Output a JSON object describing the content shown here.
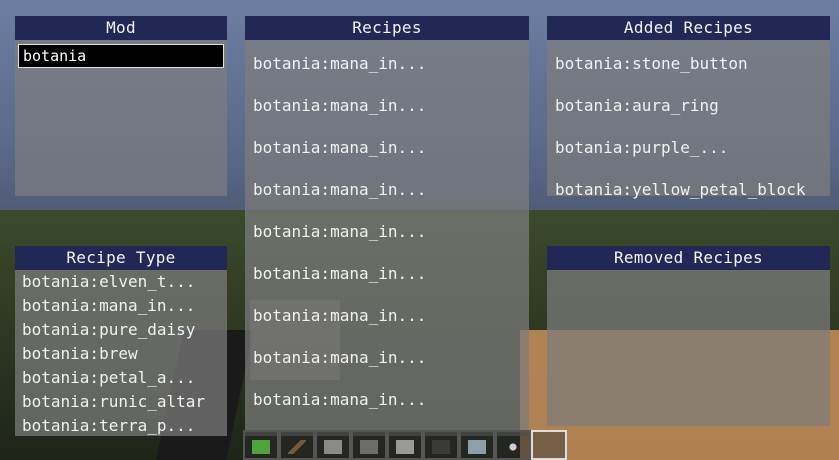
{
  "mod_panel": {
    "title": "Mod",
    "search_value": "botania"
  },
  "recipes_panel": {
    "title": "Recipes",
    "items": [
      "botania:mana_in...",
      "botania:mana_in...",
      "botania:mana_in...",
      "botania:mana_in...",
      "botania:mana_in...",
      "botania:mana_in...",
      "botania:mana_in...",
      "botania:mana_in...",
      "botania:mana_in..."
    ]
  },
  "added_panel": {
    "title": "Added Recipes",
    "items": [
      "botania:stone_button",
      "botania:aura_ring",
      "botania:purple_...",
      "botania:yellow_petal_block"
    ]
  },
  "recipe_type_panel": {
    "title": "Recipe Type",
    "items": [
      "botania:elven_t...",
      "botania:mana_in...",
      "botania:pure_daisy",
      "botania:brew",
      "botania:petal_a...",
      "botania:runic_altar",
      "botania:terra_p..."
    ]
  },
  "removed_panel": {
    "title": "Removed Recipes"
  },
  "hotbar": {
    "icons": [
      "grass-block-icon",
      "stick-icon",
      "stone-block-icon",
      "cobblestone-icon",
      "andesite-icon",
      "coal-icon",
      "glass-icon",
      "flower-icon",
      "empty-slot-icon"
    ],
    "colors": {
      "grass": "#4fa33b",
      "stone": "#8a8a8a",
      "dark": "#3a3a3a",
      "glass": "#b9d4e6"
    }
  },
  "theme": {
    "header_bg": "#222855",
    "panel_bg": "rgba(125,125,125,0.72)",
    "text": "#f2f2f2"
  }
}
